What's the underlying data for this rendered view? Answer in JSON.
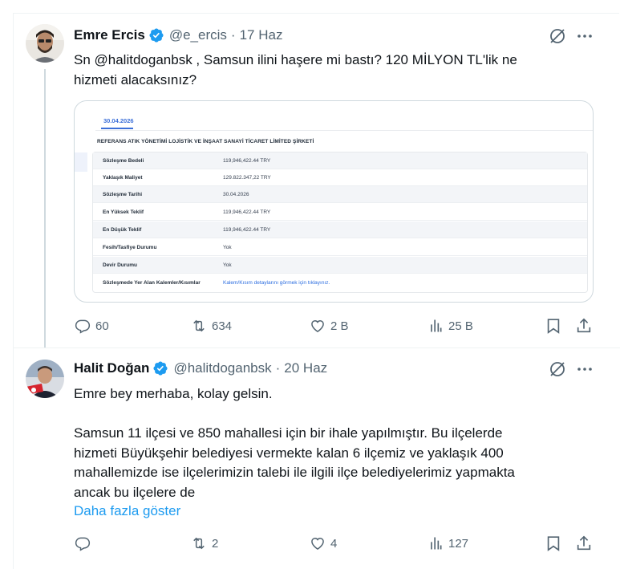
{
  "tweets": [
    {
      "name": "Emre Ercis",
      "handle": "@e_ercis",
      "dot": "·",
      "time": "17 Haz",
      "text_lines": [
        "Sn @halitdoganbsk , Samsun ilini haşere mi bastı? 120 MİLYON TL'lik ne",
        "hizmeti alacaksınız?"
      ],
      "stats": {
        "replies": "60",
        "reposts": "634",
        "likes": "2 B",
        "views": "25 B"
      }
    },
    {
      "name": "Halit Doğan",
      "handle": "@halitdoganbsk",
      "dot": "·",
      "time": "20 Haz",
      "text_lines": [
        "Emre bey merhaba, kolay gelsin.",
        "",
        "Samsun 11 ilçesi ve 850 mahallesi için bir ihale yapılmıştır. Bu ilçelerde",
        "hizmeti Büyükşehir belediyesi vermekte kalan 6 ilçemiz ve yaklaşık 400",
        "mahallemizde ise ilçelerimizin talebi ile ilgili ilçe belediyelerimiz yapmakta",
        "ancak bu ilçelere de"
      ],
      "show_more": "Daha fazla göster",
      "stats": {
        "replies": "",
        "reposts": "2",
        "likes": "4",
        "views": "127"
      }
    }
  ],
  "card": {
    "date_tab": "30.04.2026",
    "company": "REFERANS ATIK YÖNETİMİ LOJİSTİK VE İNŞAAT SANAYİ TİCARET LİMİTED ŞİRKETİ",
    "rows": [
      {
        "key": "Sözleşme Bedeli",
        "value": "119,946,422.44 TRY"
      },
      {
        "key": "Yaklaşık Maliyet",
        "value": "129.822.347,22 TRY"
      },
      {
        "key": "Sözleşme Tarihi",
        "value": "30.04.2026"
      },
      {
        "key": "En Yüksek Teklif",
        "value": "119,946,422.44 TRY"
      },
      {
        "key": "En Düşük Teklif",
        "value": "119,946,422.44 TRY"
      },
      {
        "key": "Fesih/Tasfiye Durumu",
        "value": "Yok"
      },
      {
        "key": "Devir Durumu",
        "value": "Yok"
      },
      {
        "key": "Sözleşmede Yer Alan Kalemler/Kısımlar",
        "value": "Kalem/Kısım detaylarını görmek için tıklayınız."
      }
    ]
  },
  "colors": {
    "accent": "#1d9bf0",
    "muted": "#536471",
    "text": "#0f1419",
    "border": "#cfd9de"
  },
  "icons": [
    "verified-badge-icon",
    "grok-icon",
    "more-icon",
    "reply-icon",
    "repost-icon",
    "like-icon",
    "views-icon",
    "bookmark-icon",
    "share-icon"
  ]
}
